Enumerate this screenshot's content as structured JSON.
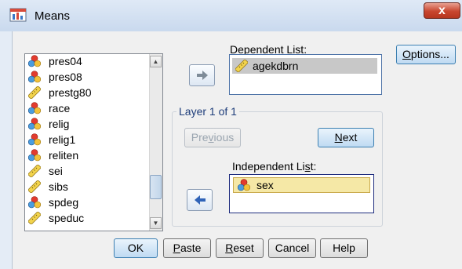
{
  "window": {
    "title": "Means",
    "close_label": "x"
  },
  "source_list": {
    "items": [
      {
        "label": "pres04",
        "type": "nominal"
      },
      {
        "label": "pres08",
        "type": "nominal"
      },
      {
        "label": "prestg80",
        "type": "scale"
      },
      {
        "label": "race",
        "type": "nominal"
      },
      {
        "label": "relig",
        "type": "nominal"
      },
      {
        "label": "relig1",
        "type": "nominal"
      },
      {
        "label": "reliten",
        "type": "nominal"
      },
      {
        "label": "sei",
        "type": "scale"
      },
      {
        "label": "sibs",
        "type": "scale"
      },
      {
        "label": "spdeg",
        "type": "nominal"
      },
      {
        "label": "speduc",
        "type": "scale"
      }
    ]
  },
  "dependent": {
    "label": "Dependent List:",
    "items": [
      {
        "label": "agekdbrn",
        "type": "scale"
      }
    ]
  },
  "layer": {
    "label": "Layer 1 of 1",
    "previous_label": "Previous",
    "next_label": "Next"
  },
  "independent": {
    "label": "Independent List:",
    "items": [
      {
        "label": "sex",
        "type": "nominal"
      }
    ]
  },
  "options_label": "Options...",
  "footer": {
    "ok": "OK",
    "paste": "Paste",
    "reset": "Reset",
    "cancel": "Cancel",
    "help": "Help"
  },
  "colors": {
    "accent": "#3c7fb1",
    "selection": "#f5e8a6",
    "dialog_bg": "#f0f0f0"
  },
  "icons": {
    "nominal": "nominal-variable-icon",
    "scale": "scale-variable-icon",
    "move": "arrow-right-icon",
    "move_back": "arrow-left-icon"
  }
}
